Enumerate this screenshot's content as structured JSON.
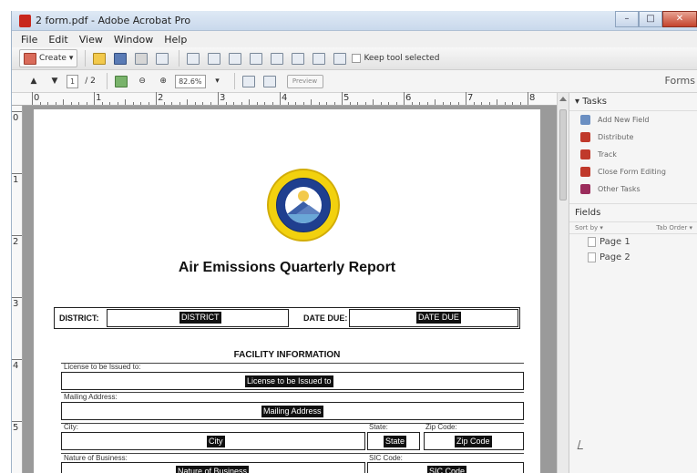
{
  "window": {
    "title": "2 form.pdf - Adobe Acrobat Pro",
    "buttons": [
      "–",
      "□",
      "✕"
    ]
  },
  "menu": [
    "File",
    "Edit",
    "View",
    "Window",
    "Help"
  ],
  "toolbar": {
    "create_label": "Create",
    "keep_tool_label": "Keep tool selected"
  },
  "nav": {
    "page_current": "1",
    "page_total": "/ 2",
    "zoom": "82.6%",
    "forms_label": "Forms",
    "preview_label": "Preview"
  },
  "ruler": {
    "h": [
      "0",
      "1",
      "2",
      "3",
      "4",
      "5",
      "6",
      "7",
      "8"
    ],
    "v": [
      "0",
      "1",
      "2",
      "3",
      "4",
      "5"
    ]
  },
  "panel": {
    "tasks_header": "▾ Tasks",
    "tasks": [
      {
        "label": "Add New Field",
        "color": "#6b8fc2"
      },
      {
        "label": "Distribute",
        "color": "#c0392b"
      },
      {
        "label": "Track",
        "color": "#c0392b"
      },
      {
        "label": "Close Form Editing",
        "color": "#c0392b"
      },
      {
        "label": "Other Tasks",
        "color": "#9b2c5c"
      }
    ],
    "fields_header": "Fields",
    "sort_by": "Sort by ▾",
    "tab_order": "Tab Order ▾",
    "pages": [
      "Page 1",
      "Page 2"
    ]
  },
  "document": {
    "title": "Air Emissions Quarterly Report",
    "district_label": "DISTRICT:",
    "district_field": "DISTRICT",
    "date_due_label": "DATE DUE:",
    "date_due_field": "DATE DUE",
    "section_header": "FACILITY INFORMATION",
    "license_label": "License to be Issued to:",
    "license_field": "License to be Issued to",
    "mailing_label": "Mailing Address:",
    "mailing_field": "Mailing Address",
    "city_label": "City:",
    "city_field": "City",
    "state_label": "State:",
    "state_field": "State",
    "zip_label": "Zip Code:",
    "zip_field": "Zip Code",
    "nature_label": "Nature of Business:",
    "nature_field": "Nature of Business",
    "sic_label": "SIC Code:",
    "sic_field": "SIC Code"
  }
}
